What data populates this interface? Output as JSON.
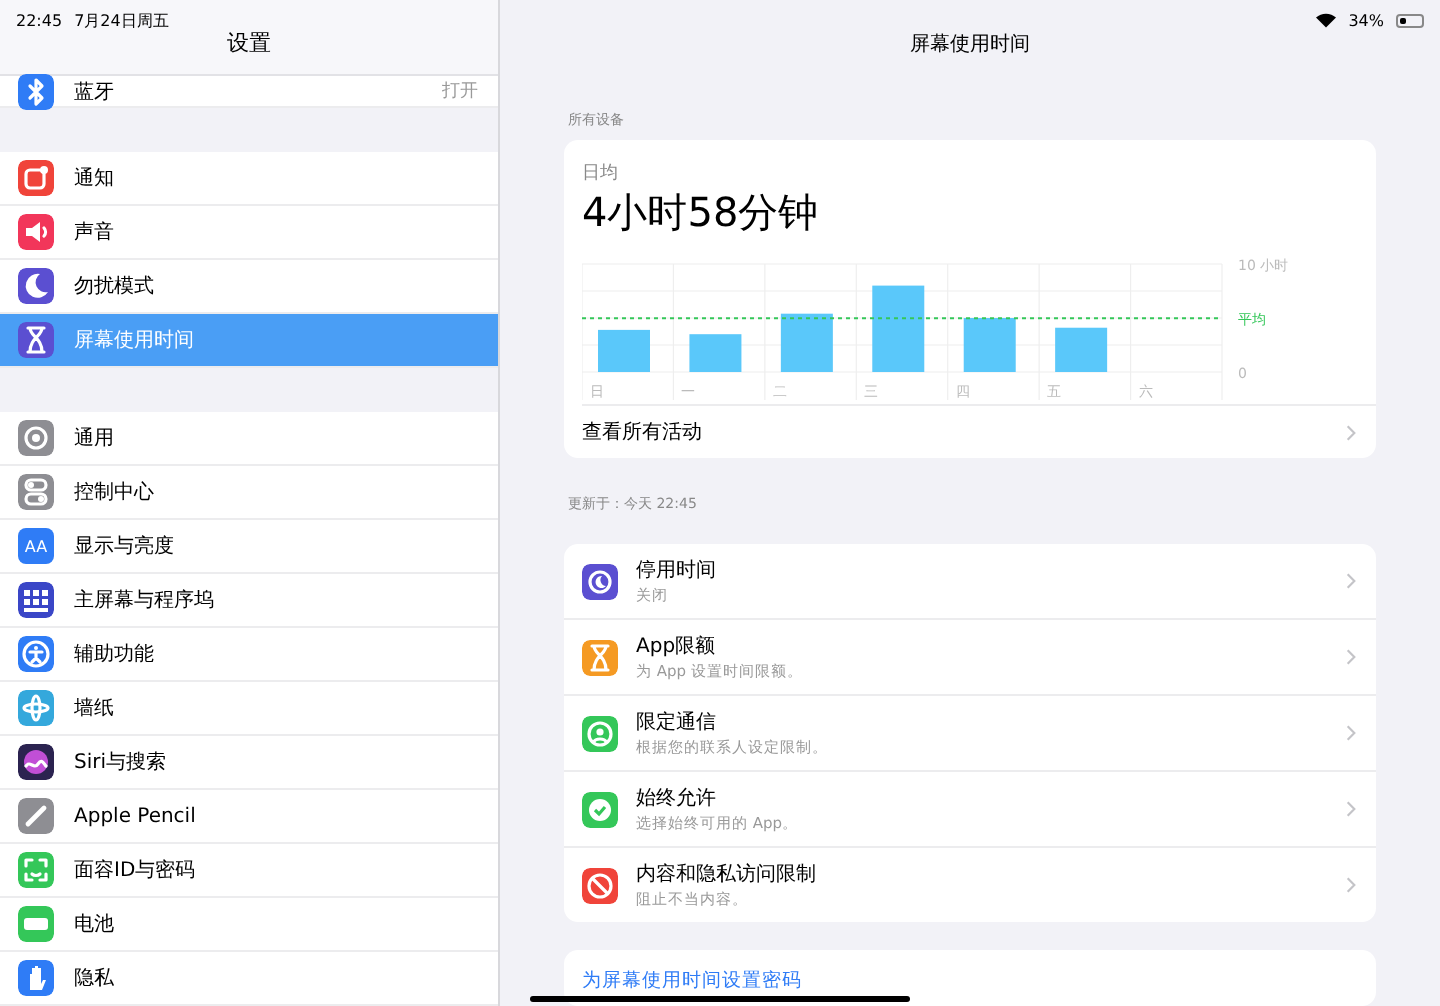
{
  "status_bar": {
    "time": "22:45",
    "date": "7月24日周五",
    "battery": "34%"
  },
  "sidebar": {
    "title": "设置",
    "groups": [
      {
        "items": [
          {
            "label": "蓝牙",
            "value": "打开",
            "selected": false,
            "color": "#2f7cf6"
          }
        ]
      },
      {
        "items": [
          {
            "label": "通知",
            "selected": false,
            "color": "#f0443a"
          },
          {
            "label": "声音",
            "selected": false,
            "color": "#f2365a"
          },
          {
            "label": "勿扰模式",
            "selected": false,
            "color": "#5b4fd1"
          },
          {
            "label": "屏幕使用时间",
            "selected": true,
            "color": "#5b4fd1"
          }
        ]
      },
      {
        "items": [
          {
            "label": "通用",
            "selected": false,
            "color": "#8e8e93"
          },
          {
            "label": "控制中心",
            "selected": false,
            "color": "#8e8e93"
          },
          {
            "label": "显示与亮度",
            "selected": false,
            "color": "#2f7cf6",
            "glyph": "AA"
          },
          {
            "label": "主屏幕与程序坞",
            "selected": false,
            "color": "#3a46c7"
          },
          {
            "label": "辅助功能",
            "selected": false,
            "color": "#2f7cf6"
          },
          {
            "label": "墙纸",
            "selected": false,
            "color": "#34a8dc"
          },
          {
            "label": "Siri与搜索",
            "selected": false,
            "color": "#2b2350"
          },
          {
            "label": "Apple Pencil",
            "selected": false,
            "color": "#8e8e93"
          },
          {
            "label": "面容ID与密码",
            "selected": false,
            "color": "#34c759"
          },
          {
            "label": "电池",
            "selected": false,
            "color": "#34c759"
          },
          {
            "label": "隐私",
            "selected": false,
            "color": "#2f7cf6"
          }
        ]
      }
    ]
  },
  "detail": {
    "title": "屏幕使用时间",
    "section_caption": "所有设备",
    "summary": {
      "caption": "日均",
      "value": "4小时58分钟",
      "chart_data": {
        "type": "bar",
        "categories": [
          "日",
          "一",
          "二",
          "三",
          "四",
          "五",
          "六"
        ],
        "series": [
          {
            "color": "#5ac8fa",
            "values": [
              3.9,
              3.5,
              5.4,
              8.0,
              5.0,
              4.1,
              null
            ]
          }
        ],
        "ylim": [
          0,
          10
        ],
        "yticks": [
          {
            "value": 0,
            "label": "0"
          },
          {
            "value": 10,
            "label": "10 小时"
          }
        ],
        "annotations": [
          {
            "text": "平均"
          }
        ]
      },
      "link": "查看所有活动"
    },
    "updated": "更新于：今天 22:45",
    "options": [
      {
        "title": "停用时间",
        "subtitle": "关闭",
        "color": "#5b4fd1"
      },
      {
        "title": "App限额",
        "subtitle": "为 App 设置时间限额。",
        "color": "#f59a23"
      },
      {
        "title": "限定通信",
        "subtitle": "根据您的联系人设定限制。",
        "color": "#34c759"
      },
      {
        "title": "始终允许",
        "subtitle": "选择始终可用的 App。",
        "color": "#34c759"
      },
      {
        "title": "内容和隐私访问限制",
        "subtitle": "阻止不当内容。",
        "color": "#f0443a"
      }
    ],
    "passcode_link": "为屏幕使用时间设置密码"
  }
}
